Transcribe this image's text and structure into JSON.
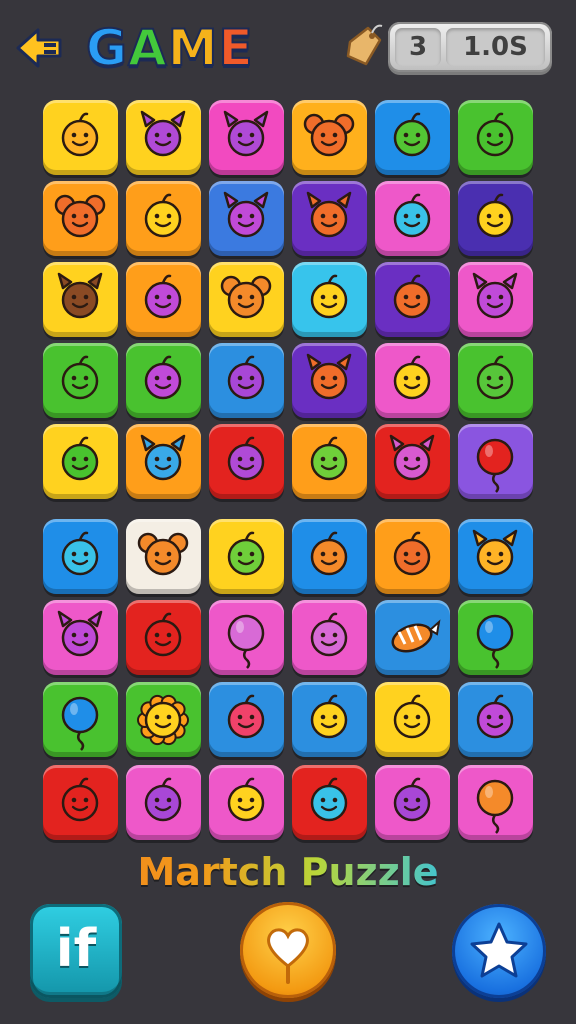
{
  "header": {
    "title_letters": [
      {
        "ch": "G",
        "color": "#2a9df4"
      },
      {
        "ch": "A",
        "color": "#43c93b"
      },
      {
        "ch": "M",
        "color": "#f5b21b"
      },
      {
        "ch": "E",
        "color": "#f05a2a"
      }
    ],
    "back_icon": "arrow-left-icon",
    "tag_icon": "price-tag-icon",
    "moves": "3",
    "time": "1.0S"
  },
  "board": {
    "rows": [
      [
        {
          "bg": "#ffd21f",
          "face": "#ffb326",
          "kind": "round"
        },
        {
          "bg": "#ffd21f",
          "face": "#b04ad6",
          "kind": "horned"
        },
        {
          "bg": "#f24ac0",
          "face": "#b04ad6",
          "kind": "horned"
        },
        {
          "bg": "#ffb01c",
          "face": "#f06d2a",
          "kind": "eared"
        },
        {
          "bg": "#1f8ee8",
          "face": "#53c534",
          "kind": "round"
        },
        {
          "bg": "#49c22f",
          "face": "#49c22f",
          "kind": "round"
        }
      ],
      [
        {
          "bg": "#ff9e1a",
          "face": "#f06d2a",
          "kind": "eared"
        },
        {
          "bg": "#ff9e1a",
          "face": "#ffd21f",
          "kind": "round"
        },
        {
          "bg": "#3b7ae0",
          "face": "#c04ad8",
          "kind": "horned"
        },
        {
          "bg": "#6a2fc2",
          "face": "#f06d2a",
          "kind": "horned"
        },
        {
          "bg": "#ee58c9",
          "face": "#39c2e8",
          "kind": "round"
        },
        {
          "bg": "#4a2fb0",
          "face": "#ffd21f",
          "kind": "round"
        }
      ],
      [
        {
          "bg": "#ffd21f",
          "face": "#8a4a24",
          "kind": "horned"
        },
        {
          "bg": "#ff9e1a",
          "face": "#c04ad8",
          "kind": "round"
        },
        {
          "bg": "#ffd21f",
          "face": "#f48a2a",
          "kind": "eared"
        },
        {
          "bg": "#37c4ec",
          "face": "#ffd21f",
          "kind": "round"
        },
        {
          "bg": "#6a2fc2",
          "face": "#f06d2a",
          "kind": "round"
        },
        {
          "bg": "#ee58c9",
          "face": "#c04ad8",
          "kind": "horned"
        }
      ],
      [
        {
          "bg": "#49c22f",
          "face": "#49c22f",
          "kind": "round"
        },
        {
          "bg": "#49c22f",
          "face": "#c04ad8",
          "kind": "round"
        },
        {
          "bg": "#2c8fe0",
          "face": "#a847d6",
          "kind": "round"
        },
        {
          "bg": "#6a2fc2",
          "face": "#f06d2a",
          "kind": "horned"
        },
        {
          "bg": "#ee58c9",
          "face": "#ffd21f",
          "kind": "round"
        },
        {
          "bg": "#49c22f",
          "face": "#57c63a",
          "kind": "round"
        }
      ],
      [
        {
          "bg": "#ffd21f",
          "face": "#49c22f",
          "kind": "round"
        },
        {
          "bg": "#ff9e1a",
          "face": "#39a9e8",
          "kind": "horned"
        },
        {
          "bg": "#e3231f",
          "face": "#b04ad6",
          "kind": "round"
        },
        {
          "bg": "#ff9e1a",
          "face": "#6fcf3a",
          "kind": "round"
        },
        {
          "bg": "#e3231f",
          "face": "#d85ad0",
          "kind": "horned"
        },
        {
          "bg": "#8a55e0",
          "face": "#e3231f",
          "kind": "balloon"
        }
      ],
      [
        {
          "bg": "#1f8ee8",
          "face": "#39c2e8",
          "kind": "round"
        },
        {
          "bg": "#f4eee4",
          "face": "#f48a2a",
          "kind": "eared"
        },
        {
          "bg": "#ffd21f",
          "face": "#6fcf3a",
          "kind": "round"
        },
        {
          "bg": "#1f8ee8",
          "face": "#f48a2a",
          "kind": "round"
        },
        {
          "bg": "#ff9e1a",
          "face": "#f06d2a",
          "kind": "round"
        },
        {
          "bg": "#1f8ee8",
          "face": "#ffb326",
          "kind": "horned"
        }
      ],
      [
        {
          "bg": "#ee58c9",
          "face": "#c04ad8",
          "kind": "horned"
        },
        {
          "bg": "#e3231f",
          "face": "#e3231f",
          "kind": "round"
        },
        {
          "bg": "#ee58c9",
          "face": "#d86ad6",
          "kind": "balloon"
        },
        {
          "bg": "#ee58c9",
          "face": "#d86ad6",
          "kind": "round"
        },
        {
          "bg": "#2c8fe0",
          "face": "#f48a2a",
          "kind": "candy"
        },
        {
          "bg": "#49c22f",
          "face": "#1f8ee8",
          "kind": "balloon"
        }
      ],
      [
        {
          "bg": "#49c22f",
          "face": "#1f8ee8",
          "kind": "balloon"
        },
        {
          "bg": "#49c22f",
          "face": "#ffd21f",
          "kind": "flower"
        },
        {
          "bg": "#2c8fe0",
          "face": "#f0426a",
          "kind": "round"
        },
        {
          "bg": "#2c8fe0",
          "face": "#ffd21f",
          "kind": "round"
        },
        {
          "bg": "#ffd21f",
          "face": "#ffd21f",
          "kind": "round"
        },
        {
          "bg": "#2c8fe0",
          "face": "#c04ad8",
          "kind": "round"
        }
      ],
      [
        {
          "bg": "#e3231f",
          "face": "#e3231f",
          "kind": "round"
        },
        {
          "bg": "#ee58c9",
          "face": "#a847d6",
          "kind": "round"
        },
        {
          "bg": "#ee58c9",
          "face": "#ffd21f",
          "kind": "round"
        },
        {
          "bg": "#e3231f",
          "face": "#39c2e8",
          "kind": "round"
        },
        {
          "bg": "#ee58c9",
          "face": "#a847d6",
          "kind": "round"
        },
        {
          "bg": "#ee58c9",
          "face": "#f48a2a",
          "kind": "balloon"
        }
      ]
    ]
  },
  "footer": {
    "title": "Martch Puzzle",
    "buttons": [
      {
        "label": "if",
        "icon": "if-icon"
      },
      {
        "label": "",
        "icon": "heart-lollipop-icon"
      },
      {
        "label": "",
        "icon": "star-icon"
      }
    ]
  }
}
